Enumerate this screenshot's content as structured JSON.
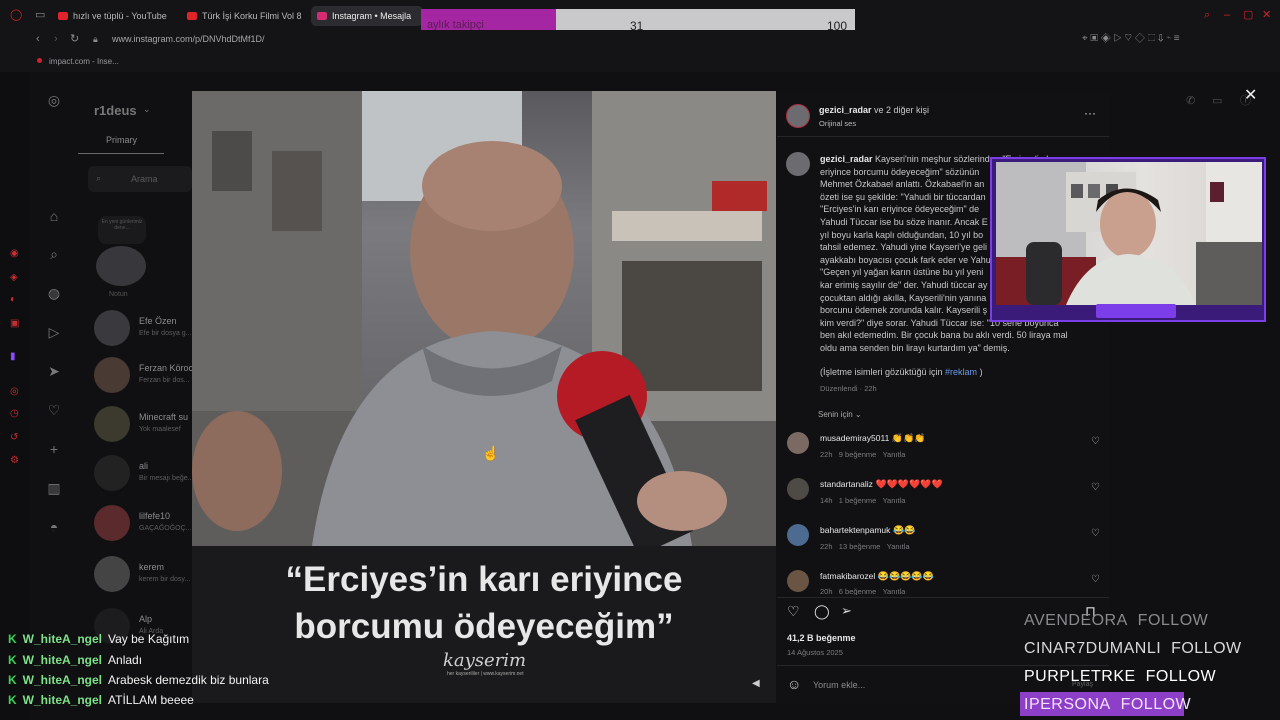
{
  "browser": {
    "tabs": [
      {
        "label": "hızlı ve tüplü - YouTube"
      },
      {
        "label": "Türk İşi Korku Filmi Vol 8 |"
      },
      {
        "label": "Instagram • Mesajla"
      }
    ],
    "url": "www.instagram.com/p/DNVhdDtMf1D/",
    "bookmark": "impact.com - Inse..."
  },
  "follower_goal": {
    "label": "aylık takipçi",
    "current": "31",
    "goal": "100",
    "progress": 0.31
  },
  "instagram": {
    "username": "r1deus",
    "primary_tab": "Primary",
    "search_placeholder": "Arama",
    "note_label": "Notun",
    "note_bubble": "En yeni günlerimiz dene...",
    "dms": [
      {
        "name": "Efe Özen",
        "preview": "Efe bir dosya g..."
      },
      {
        "name": "Ferzan Körocl",
        "preview": "Ferzan bir dos..."
      },
      {
        "name": "Minecraft su",
        "preview": "Yok maalesef"
      },
      {
        "name": "ali",
        "preview": "Bir mesajı beğe..."
      },
      {
        "name": "lilfefe10",
        "preview": "GAÇAĞOĞOÇ..."
      },
      {
        "name": "kerem",
        "preview": "kerem bir dosy..."
      },
      {
        "name": "Alp",
        "preview": "Ali Arda"
      }
    ],
    "caption_lines": [
      "“Erciyes’in karı eriyince",
      "borcumu ödeyeceğim”"
    ],
    "watermark": "kayserim",
    "watermark_sub": "her kayserililer | www.kayserim.net",
    "post": {
      "header_user": "gezici_radar",
      "header_rest": " ve 2 diğer kişi",
      "audio": "Orijinal ses",
      "caption_user": "gezici_radar",
      "caption_lines": [
        "Kayseri'nin meşhur sözlerinden \"Erciyes'in kar",
        "eriyince borcumu ödeyeceğim\" sözünün",
        "Mehmet Özkabael anlattı. Özkabael'in an",
        "özeti ise şu şekilde: \"Yahudi bir tüccardan",
        "\"Erciyes'in karı eriyince ödeyeceğim\" de",
        "Yahudi Tüccar ise bu söze inanır. Ancak E",
        "yıl boyu karla kaplı olduğundan, 10 yıl bo",
        "tahsil edemez. Yahudi yine Kayseri'ye geli",
        "ayakkabı boyacısı çocuk fark eder ve Yahu",
        "\"Geçen yıl yağan karın üstüne bu yıl yeni",
        "kar erimiş sayılır de\" der. Yahudi tüccar ay",
        "çocuktan aldığı akılla, Kayserili'nin yanına",
        "borcunu ödemek zorunda kalır. Kayserili ş",
        "kim verdi?\" diye sorar. Yahudi Tüccar ise: \"10 sene boyunca",
        "ben akıl edemedim. Bir çocuk bana bu aklı verdi. 50 liraya mal",
        "oldu ama senden bin lirayı kurtardım ya\" demiş."
      ],
      "ad_note_prefix": "(İşletme isimleri gözüktüğü için ",
      "ad_note_tag": "#reklam",
      "ad_note_suffix": " )",
      "edited": "Düzenlendi · 22h",
      "sort": "Senin için",
      "comments": [
        {
          "user": "musademiray5011",
          "text": "👏👏👏",
          "time": "22h",
          "likes": "9 beğenme",
          "reply": "Yanıtla"
        },
        {
          "user": "standartanaliz",
          "text": "❤️❤️❤️❤️❤️❤️",
          "time": "14h",
          "likes": "1 beğenme",
          "reply": "Yanıtla"
        },
        {
          "user": "bahartektenpamuk",
          "text": "😂😂",
          "time": "22h",
          "likes": "13 beğenme",
          "reply": "Yanıtla"
        },
        {
          "user": "fatmakibarozel",
          "text": "😂😂😂😂😂",
          "time": "20h",
          "likes": "6 beğenme",
          "reply": "Yanıtla"
        }
      ],
      "likes_total": "41,2 B beğenme",
      "date": "14 Ağustos 2025",
      "comment_placeholder": "Yorum ekle...",
      "share_label": "Paylaş"
    }
  },
  "chat": [
    {
      "user": "W_hiteA_ngel",
      "message": "Vay be Kağıtım"
    },
    {
      "user": "W_hiteA_ngel",
      "message": "Anladı"
    },
    {
      "user": "W_hiteA_ngel",
      "message": "Arabesk demezdik biz bunlara"
    },
    {
      "user": "W_hiteA_ngel",
      "message": "ATİLLAM beeee"
    }
  ],
  "follow_alerts": [
    {
      "name": "AVENDEORA",
      "action": "FOLLOW",
      "color": "#8a8a8e"
    },
    {
      "name": "CINAR7DUMANLI",
      "action": "FOLLOW",
      "color": "#d0d0d2"
    },
    {
      "name": "PURPLETRKE",
      "action": "FOLLOW",
      "color": "#ffffff"
    },
    {
      "name": "IPERSONA",
      "action": "FOLLOW",
      "color": "#f0d9ff"
    }
  ],
  "colors": {
    "accent": "#a526a3",
    "webcam_border": "#7b3ee8",
    "chat_user": "#7fe08a",
    "alert_highlight": "#8e3fc7"
  }
}
